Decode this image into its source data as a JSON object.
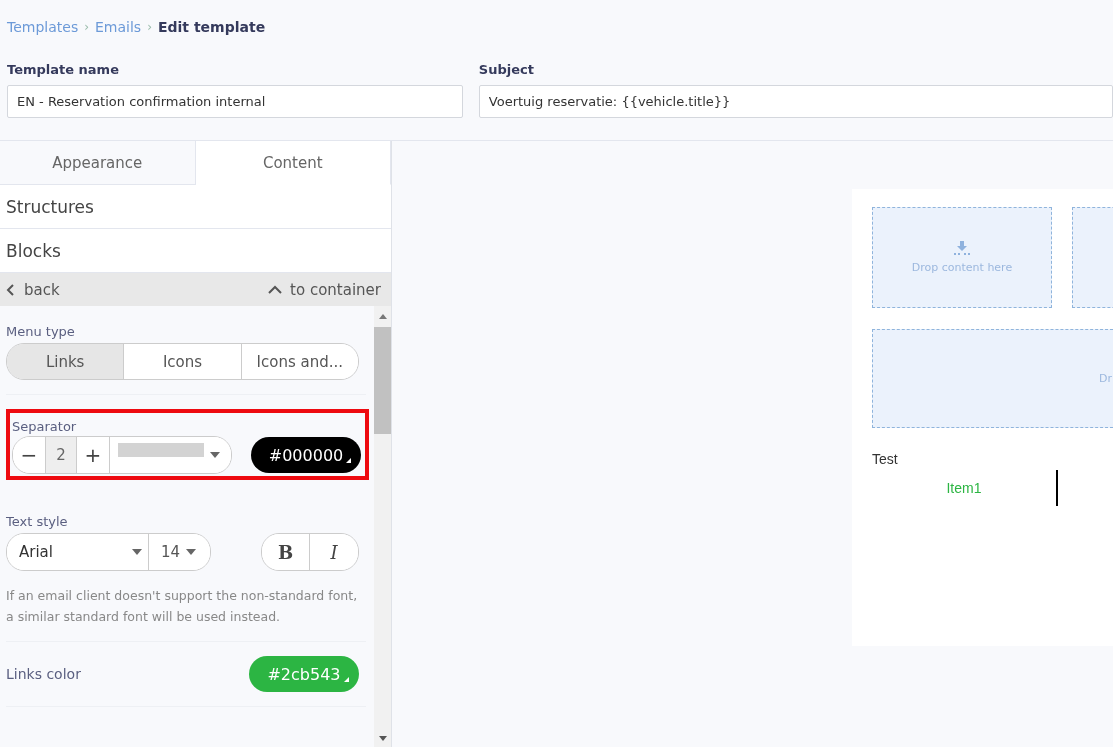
{
  "breadcrumb": [
    {
      "label": "Templates",
      "kind": "link"
    },
    {
      "label": "Emails",
      "kind": "link"
    },
    {
      "label": "Edit template",
      "kind": "current"
    }
  ],
  "breadcrumb_separator": "›",
  "fields": [
    {
      "label": "Template name",
      "value": "EN - Reservation confirmation internal"
    },
    {
      "label": "Subject",
      "value": "Voertuig reservatie: {{vehicle.title}}"
    }
  ],
  "tabs": [
    {
      "label": "Appearance",
      "selected": false
    },
    {
      "label": "Content",
      "selected": true
    }
  ],
  "sections": [
    "Structures",
    "Blocks"
  ],
  "nav": {
    "back": "back",
    "up": "to container"
  },
  "menu_type": {
    "label": "Menu type",
    "options": [
      {
        "label": "Links",
        "selected": true
      },
      {
        "label": "Icons",
        "selected": false
      },
      {
        "label": "Icons and...",
        "selected": false
      }
    ]
  },
  "separator": {
    "label": "Separator",
    "minus": "−",
    "value": "2",
    "plus": "+",
    "color": "#000000",
    "highlighted": true
  },
  "text_style": {
    "label": "Text style",
    "font": "Arial",
    "size": "14",
    "bold": "B",
    "italic": "I",
    "note": "If an email client doesn't support the non-standard font, a similar standard font will be used instead."
  },
  "links_color": {
    "label": "Links color",
    "color": "#2cb543"
  },
  "canvas": {
    "drop_zones": [
      {
        "text": "Drop content here",
        "kind": "full"
      },
      {
        "kind": "cut"
      }
    ],
    "wide_drop_zone": {
      "text": "Dr"
    },
    "menu_title": "Test",
    "menu_items": [
      "Item1"
    ]
  }
}
